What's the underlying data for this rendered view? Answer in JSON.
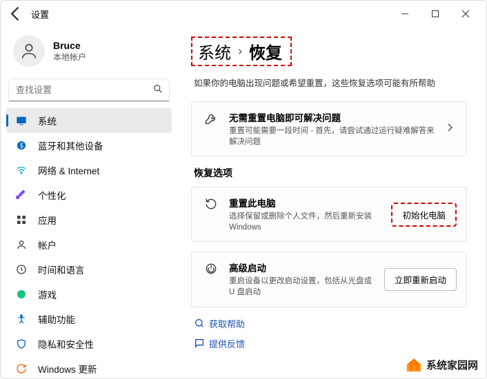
{
  "window": {
    "title": "设置"
  },
  "user": {
    "name": "Bruce",
    "subtitle": "本地帐户"
  },
  "search": {
    "placeholder": "查找设置"
  },
  "sidebar": {
    "items": [
      {
        "label": "系统",
        "iconColor": "#0067c0",
        "selected": true
      },
      {
        "label": "蓝牙和其他设备",
        "iconColor": "#0067c0"
      },
      {
        "label": "网络 & Internet",
        "iconColor": "#0ea5e9"
      },
      {
        "label": "个性化",
        "iconColor": "#7c4dff"
      },
      {
        "label": "应用",
        "iconColor": "#444"
      },
      {
        "label": "帐户",
        "iconColor": "#444"
      },
      {
        "label": "时间和语言",
        "iconColor": "#444"
      },
      {
        "label": "游戏",
        "iconColor": "#19c37d"
      },
      {
        "label": "辅助功能",
        "iconColor": "#0067c0"
      },
      {
        "label": "隐私和安全性",
        "iconColor": "#0067c0"
      },
      {
        "label": "Windows 更新",
        "iconColor": "#f7630c"
      }
    ]
  },
  "breadcrumb": {
    "root": "系统",
    "current": "恢复"
  },
  "intro": "如果你的电脑出现问题或希望重置，这些恢复选项可能有所帮助",
  "troubleshootCard": {
    "title": "无需重置电脑即可解决问题",
    "desc": "重置可能需要一段时间 - 首先，请尝试通过运行疑难解答来解决问题"
  },
  "sectionTitle": "恢复选项",
  "resetCard": {
    "title": "重置此电脑",
    "desc": "选择保留或删除个人文件，然后重新安装 Windows",
    "button": "初始化电脑"
  },
  "advancedCard": {
    "title": "高级启动",
    "desc": "重启设备以更改启动设置，包括从光盘或 U 盘启动",
    "button": "立即重新启动"
  },
  "links": {
    "help": "获取帮助",
    "feedback": "提供反馈"
  },
  "brand": "系统家园网"
}
